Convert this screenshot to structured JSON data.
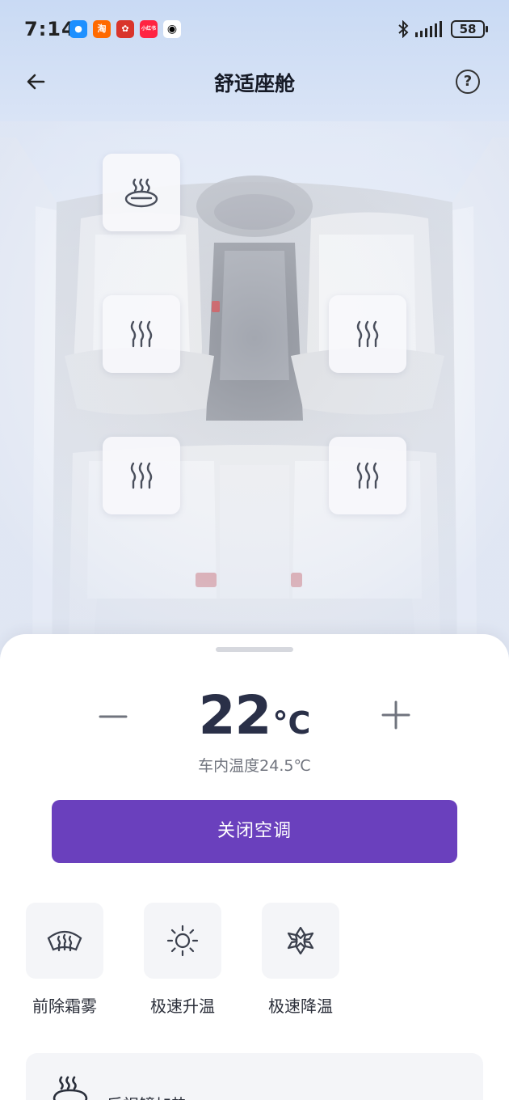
{
  "status_bar": {
    "time": "7:14",
    "apps": [
      {
        "name": "messages-app-icon",
        "glyph": "●",
        "color": "#1e90ff"
      },
      {
        "name": "taobao-app-icon",
        "glyph": "淘",
        "color": "#ff6a00"
      },
      {
        "name": "app-icon-red",
        "glyph": "✿",
        "color": "#d9342b"
      },
      {
        "name": "xiaohongshu-app-icon",
        "glyph": "小红书",
        "color": "#ff2442"
      },
      {
        "name": "qq-app-icon",
        "glyph": "🐧",
        "color": "#ffffff"
      }
    ],
    "battery": "58"
  },
  "header": {
    "title": "舒适座舱"
  },
  "temperature": {
    "set_value": "22",
    "unit": "°C",
    "inside_label": "车内温度24.5℃"
  },
  "ac_button_label": "关闭空调",
  "quick_actions": [
    {
      "label": "前除霜雾",
      "icon": "front-defrost-icon"
    },
    {
      "label": "极速升温",
      "icon": "sun-icon"
    },
    {
      "label": "极速降温",
      "icon": "snowflake-icon"
    }
  ],
  "mirror_heating_label": "后视镜加热",
  "colors": {
    "accent": "#6a40bd",
    "text_dark": "#2a3048"
  }
}
